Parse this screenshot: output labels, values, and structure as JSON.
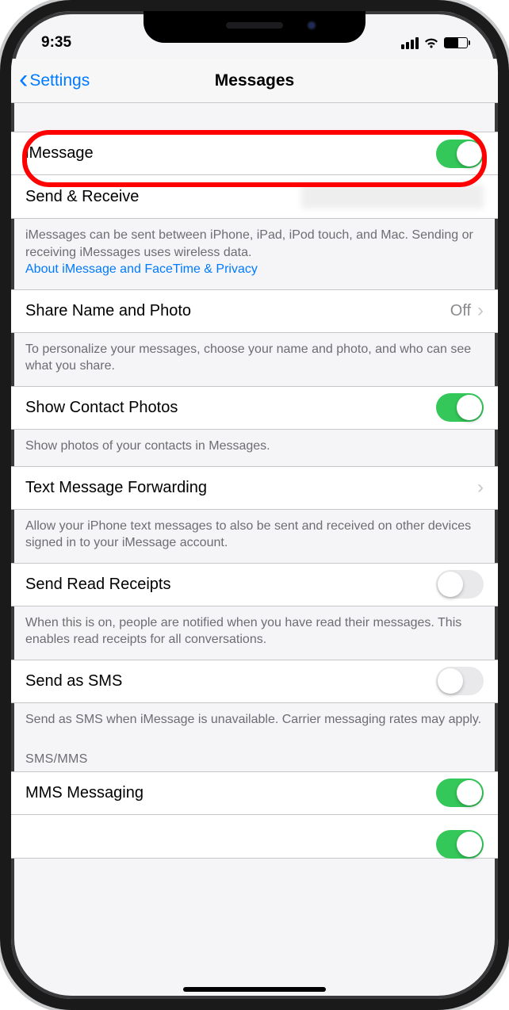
{
  "status": {
    "time": "9:35"
  },
  "nav": {
    "back": "Settings",
    "title": "Messages"
  },
  "rows": {
    "imessage": {
      "label": "iMessage",
      "on": true
    },
    "send_receive": {
      "label": "Send & Receive"
    },
    "share_name": {
      "label": "Share Name and Photo",
      "value": "Off"
    },
    "contact_photos": {
      "label": "Show Contact Photos",
      "on": true
    },
    "forwarding": {
      "label": "Text Message Forwarding"
    },
    "read_receipts": {
      "label": "Send Read Receipts",
      "on": false
    },
    "send_sms": {
      "label": "Send as SMS",
      "on": false
    },
    "mms": {
      "label": "MMS Messaging",
      "on": true
    }
  },
  "footers": {
    "imessage": "iMessages can be sent between iPhone, iPad, iPod touch, and Mac. Sending or receiving iMessages uses wireless data.",
    "imessage_link": "About iMessage and FaceTime & Privacy",
    "share_name": "To personalize your messages, choose your name and photo, and who can see what you share.",
    "contact_photos": "Show photos of your contacts in Messages.",
    "forwarding": "Allow your iPhone text messages to also be sent and received on other devices signed in to your iMessage account.",
    "read_receipts": "When this is on, people are notified when you have read their messages. This enables read receipts for all conversations.",
    "send_sms": "Send as SMS when iMessage is unavailable. Carrier messaging rates may apply."
  },
  "sections": {
    "sms_mms": "SMS/MMS"
  }
}
